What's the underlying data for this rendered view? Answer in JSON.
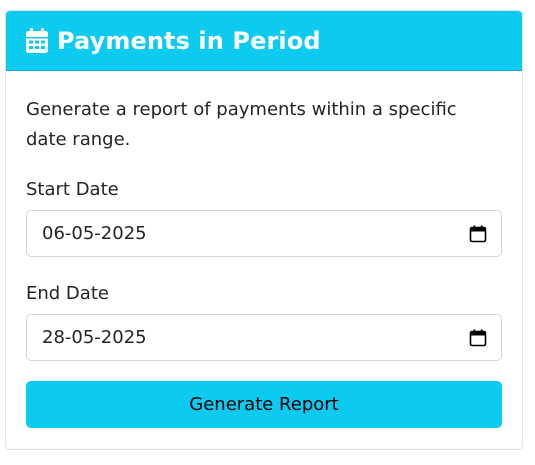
{
  "header": {
    "title": "Payments in Period",
    "icon": "calendar-icon",
    "color": "#0dcaf0"
  },
  "body": {
    "description": "Generate a report of payments within a specific date range."
  },
  "form": {
    "start_date": {
      "label": "Start Date",
      "value": "06-05-2025",
      "icon": "calendar-picker-icon"
    },
    "end_date": {
      "label": "End Date",
      "value": "28-05-2025",
      "icon": "calendar-picker-icon"
    },
    "submit_label": "Generate Report"
  }
}
